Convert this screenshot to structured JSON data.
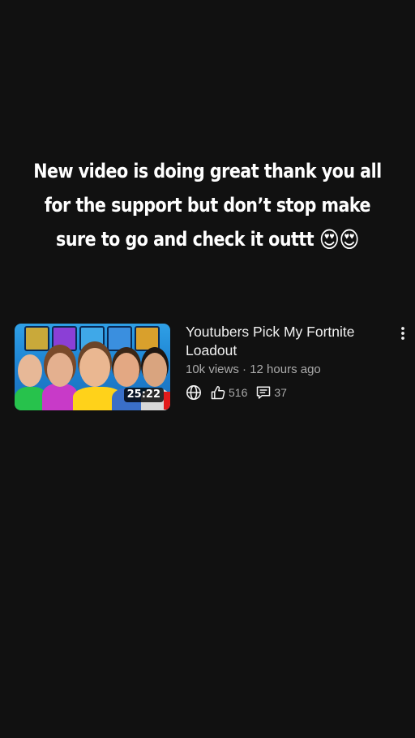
{
  "caption": {
    "line1": "New video is doing great thank you all",
    "line2": "for the support but don’t stop make",
    "line3": "sure to go and check it outtt",
    "emoji": "😍😍"
  },
  "video": {
    "title": "Youtubers Pick My Fortnite Loadout",
    "meta": "10k views · 12 hours ago",
    "duration": "25:22",
    "likes": "516",
    "comments": "37",
    "icons": [
      "globe-icon",
      "thumbs-up-icon",
      "comment-icon",
      "more-vert-icon"
    ]
  }
}
